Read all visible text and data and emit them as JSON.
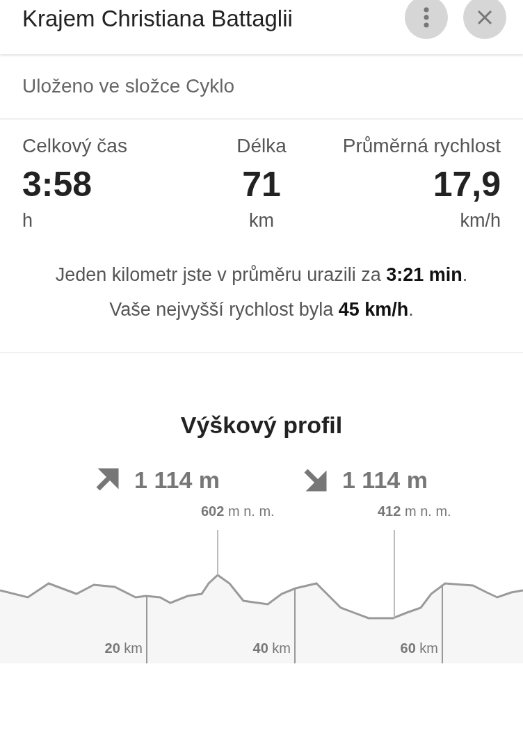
{
  "header": {
    "title": "Krajem Christiana Battaglii"
  },
  "folder": "Uloženo ve složce Cyklo",
  "stats": [
    {
      "label": "Celkový čas",
      "value": "3:58",
      "unit": "h"
    },
    {
      "label": "Délka",
      "value": "71",
      "unit": "km"
    },
    {
      "label": "Průměrná rychlost",
      "value": "17,9",
      "unit": "km/h"
    }
  ],
  "summary": [
    "Jeden kilometr jste v průměru urazili za **3:21 min**.",
    "Vaše nejvyšší rychlost byla **45 km/h**."
  ],
  "profile": {
    "title": "Výškový profil",
    "ascent": "1 114 m",
    "descent": "1 114 m",
    "peaks": [
      {
        "label": "**602** m n. m."
      },
      {
        "label": "**412** m n. m."
      }
    ],
    "km_markers": [
      {
        "label": "**20** km"
      },
      {
        "label": "**40** km"
      },
      {
        "label": "**60** km"
      }
    ]
  }
}
